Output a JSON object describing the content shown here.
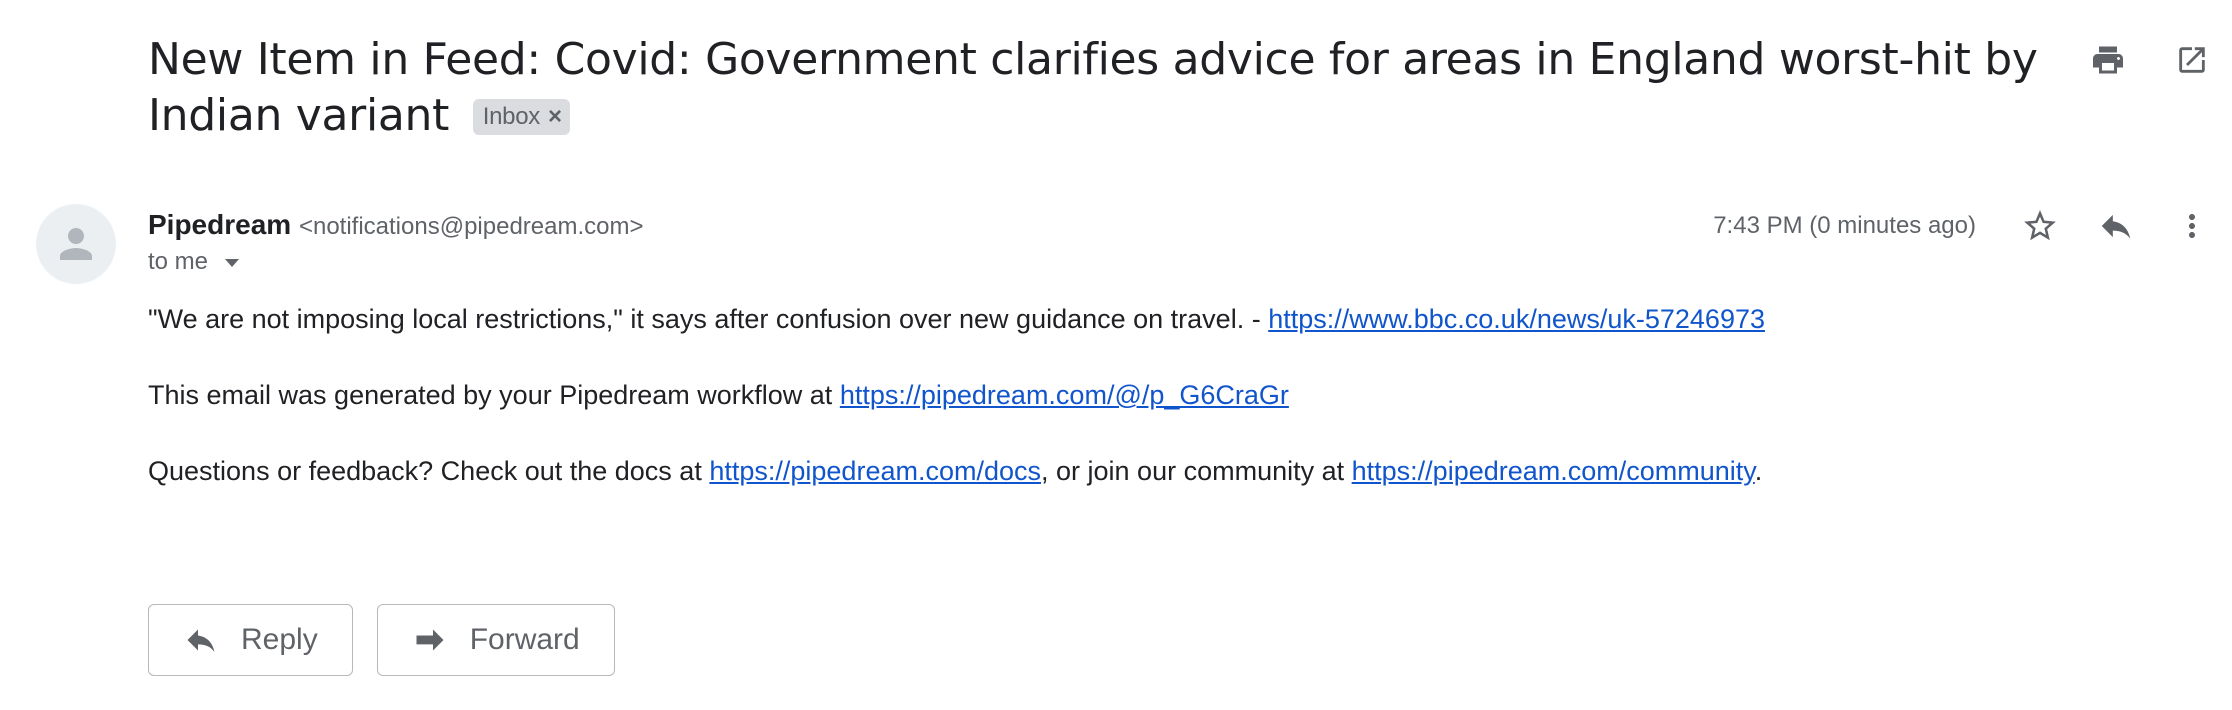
{
  "email": {
    "subject": "New Item in Feed: Covid: Government clarifies advice for areas in England worst-hit by Indian variant",
    "label": "Inbox",
    "sender_name": "Pipedream",
    "sender_email": "<notifications@pipedream.com>",
    "recipient": "to me",
    "timestamp": "7:43 PM (0 minutes ago)",
    "body": {
      "line1_text": "\"We are not imposing local restrictions,\" it says after confusion over new guidance on travel. - ",
      "line1_link": "https://www.bbc.co.uk/news/uk-57246973",
      "line2_text": "This email was generated by your Pipedream workflow at ",
      "line2_link": "https://pipedream.com/@/p_G6CraGr",
      "line3_text_a": "Questions or feedback? Check out the docs at ",
      "line3_link_a": "https://pipedream.com/docs",
      "line3_text_b": ", or join our community at ",
      "line3_link_b": "https://pipedream.com/community",
      "line3_text_c": "."
    }
  },
  "actions": {
    "reply_label": "Reply",
    "forward_label": "Forward"
  },
  "icons": {
    "print": "print-icon",
    "open_new_window": "open-in-new-window-icon",
    "star": "star-icon",
    "reply": "reply-icon",
    "more": "more-vert-icon",
    "label_remove": "close-icon",
    "recipient_details": "caret-down-icon",
    "avatar": "person-icon",
    "forward": "forward-icon"
  },
  "colors": {
    "link": "#1155cc",
    "chip_bg": "#dadce0",
    "icon": "#5f6368"
  }
}
